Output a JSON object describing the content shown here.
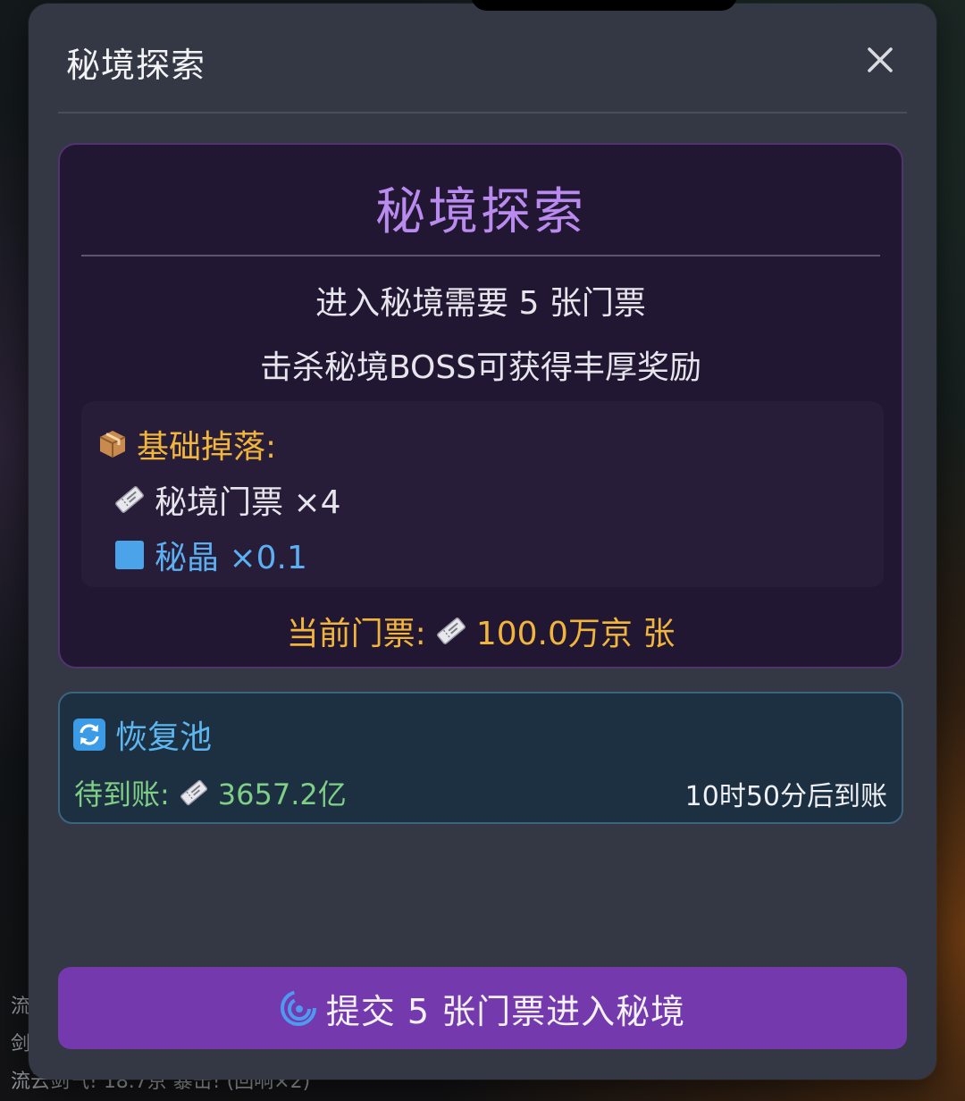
{
  "background": {
    "log_lines": [
      "流",
      "剑",
      "流云剑气! 18.7京 暴击! (回响×2)"
    ]
  },
  "modal": {
    "title": "秘境探索",
    "close_icon": "close-icon"
  },
  "secret_realm": {
    "heading": "秘境探索",
    "requirement": "进入秘境需要 5 张门票",
    "reward_hint": "击杀秘境BOSS可获得丰厚奖励",
    "drops": {
      "icon": "package-icon",
      "title": "基础掉落:",
      "items": [
        {
          "icon": "ticket-icon",
          "label": "秘境门票 ×4"
        },
        {
          "icon": "crystal-square-icon",
          "label": "秘晶 ×0.1"
        }
      ]
    },
    "current_tickets": {
      "label": "当前门票:",
      "icon": "ticket-icon",
      "value": "100.0万京 张"
    }
  },
  "recovery_pool": {
    "icon": "refresh-icon",
    "title": "恢复池",
    "pending_label": "待到账:",
    "pending_icon": "ticket-icon",
    "pending_value": "3657.2亿",
    "eta": "10时50分后到账"
  },
  "submit": {
    "icon": "vortex-icon",
    "label": "提交 5 张门票进入秘境"
  },
  "colors": {
    "modal_bg": "#343844",
    "card_bg": "#221733",
    "heading": "#b98bee",
    "gold": "#f1b53d",
    "crystal_blue": "#5cb0f2",
    "pool_bg": "#1c3042",
    "pool_green": "#7fcf86",
    "button": "#7339ad"
  }
}
